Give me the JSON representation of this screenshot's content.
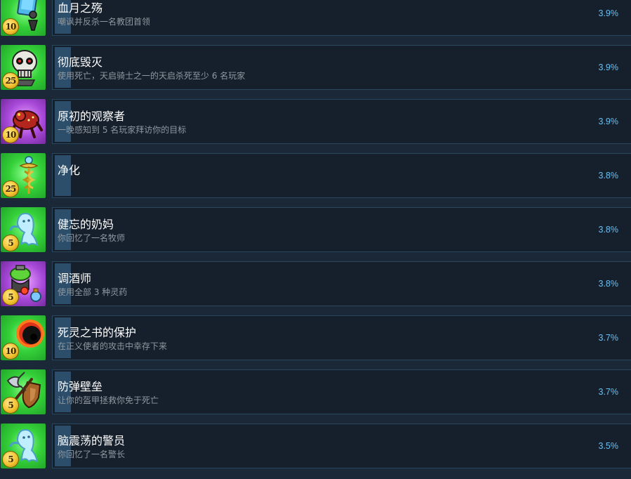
{
  "achievements": [
    {
      "title": "血月之殇",
      "description": "嘲讽并反杀一名教团首领",
      "percent": "3.9%",
      "points": "10",
      "icon": "blood-moon-card-icon",
      "bg": "green"
    },
    {
      "title": "彻底毁灭",
      "description": "使用死亡，天启骑士之一的天启杀死至少 6 名玩家",
      "percent": "3.9%",
      "points": "25",
      "icon": "skull-icon",
      "bg": "green"
    },
    {
      "title": "原初的观察者",
      "description": "一晚感知到 5 名玩家拜访你的目标",
      "percent": "3.9%",
      "points": "10",
      "icon": "red-beast-icon",
      "bg": "purple"
    },
    {
      "title": "净化",
      "description": "",
      "percent": "3.8%",
      "points": "25",
      "icon": "caduceus-icon",
      "bg": "green"
    },
    {
      "title": "健忘的奶妈",
      "description": "你回忆了一名牧师",
      "percent": "3.8%",
      "points": "5",
      "icon": "ghost-icon",
      "bg": "green"
    },
    {
      "title": "调酒师",
      "description": "使用全部 3 种灵药",
      "percent": "3.8%",
      "points": "5",
      "icon": "potion-icon",
      "bg": "purple"
    },
    {
      "title": "死灵之书的保护",
      "description": "在正义使者的攻击中幸存下来",
      "percent": "3.7%",
      "points": "10",
      "icon": "dark-orb-icon",
      "bg": "green"
    },
    {
      "title": "防弹壁垒",
      "description": "让你的盔甲拯救你免于死亡",
      "percent": "3.7%",
      "points": "5",
      "icon": "axe-shield-icon",
      "bg": "green"
    },
    {
      "title": "脑震荡的警员",
      "description": "你回忆了一名警长",
      "percent": "3.5%",
      "points": "5",
      "icon": "ghost-icon",
      "bg": "green"
    }
  ]
}
